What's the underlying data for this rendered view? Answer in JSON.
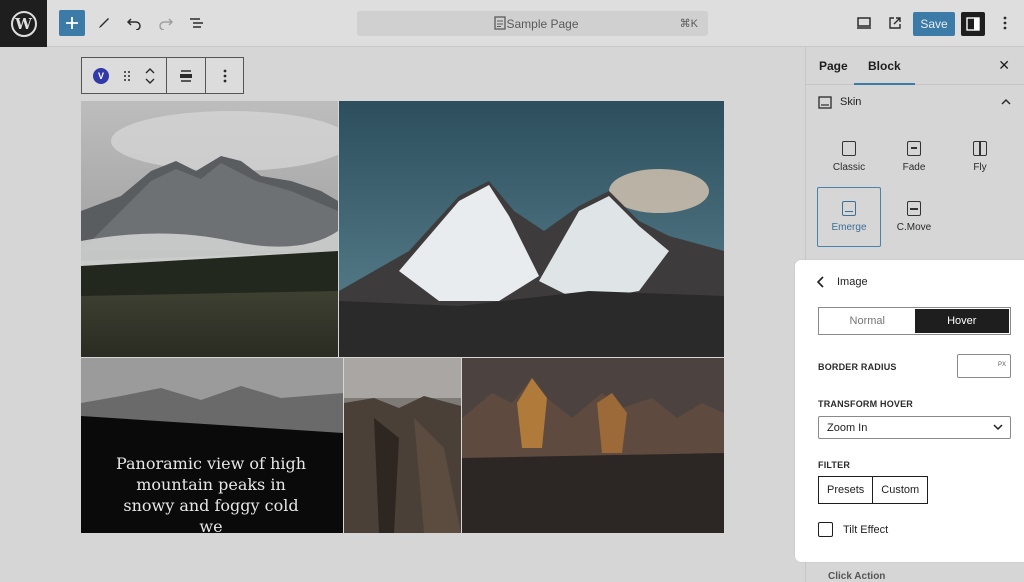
{
  "topbar": {
    "logo_alt": "W",
    "document_title": "Sample Page",
    "command_shortcut": "⌘K",
    "save_label": "Save"
  },
  "canvas": {
    "caption": "Panoramic view of high mountain peaks in snowy and foggy cold we"
  },
  "block_toolbar": {
    "badge": "V"
  },
  "sidebar": {
    "tabs": [
      {
        "label": "Page"
      },
      {
        "label": "Block"
      }
    ],
    "active_tab": "Block",
    "skin": {
      "title": "Skin",
      "options": [
        {
          "label": "Classic"
        },
        {
          "label": "Fade"
        },
        {
          "label": "Fly"
        },
        {
          "label": "Emerge"
        },
        {
          "label": "C.Move"
        }
      ],
      "selected": "Emerge"
    },
    "next_section": "Click Action"
  },
  "image_panel": {
    "title": "Image",
    "state_tabs": {
      "normal": "Normal",
      "hover": "Hover"
    },
    "active_state": "Hover",
    "border_radius": {
      "label": "BORDER RADIUS",
      "value": "",
      "unit": "PX"
    },
    "transform_hover": {
      "label": "TRANSFORM HOVER",
      "value": "Zoom In"
    },
    "filter": {
      "label": "FILTER",
      "options": [
        "Presets",
        "Custom"
      ]
    },
    "tilt_effect": {
      "label": "Tilt Effect",
      "checked": false
    }
  },
  "colors": {
    "accent": "#3c7aa8",
    "dark": "#1e1e1e",
    "selected_skin": "#4a82ad"
  }
}
